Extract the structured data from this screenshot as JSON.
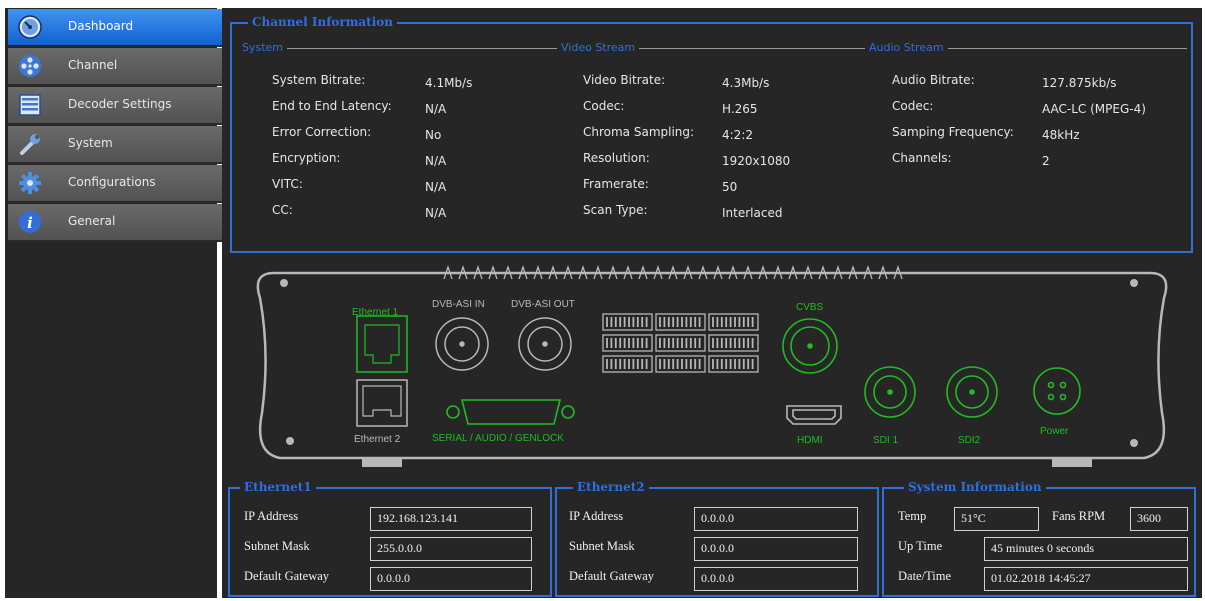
{
  "sidebar": {
    "items": [
      {
        "label": "Dashboard",
        "icon": "gauge-icon",
        "active": true
      },
      {
        "label": "Channel",
        "icon": "film-reel-icon",
        "active": false
      },
      {
        "label": "Decoder Settings",
        "icon": "list-icon",
        "active": false
      },
      {
        "label": "System",
        "icon": "wrench-icon",
        "active": false
      },
      {
        "label": "Configurations",
        "icon": "gear-icon",
        "active": false
      },
      {
        "label": "General",
        "icon": "info-icon",
        "active": false
      }
    ]
  },
  "channel_info": {
    "title": "Channel Information",
    "system": {
      "title": "System",
      "rows": [
        {
          "label": "System Bitrate:",
          "value": "4.1Mb/s"
        },
        {
          "label": "End to End Latency:",
          "value": "N/A"
        },
        {
          "label": "Error Correction:",
          "value": "No"
        },
        {
          "label": "Encryption:",
          "value": "N/A"
        },
        {
          "label": "VITC:",
          "value": "N/A"
        },
        {
          "label": "CC:",
          "value": "N/A"
        }
      ]
    },
    "video": {
      "title": "Video Stream",
      "rows": [
        {
          "label": "Video Bitrate:",
          "value": "4.3Mb/s"
        },
        {
          "label": "Codec:",
          "value": "H.265"
        },
        {
          "label": "Chroma Sampling:",
          "value": "4:2:2"
        },
        {
          "label": "Resolution:",
          "value": "1920x1080"
        },
        {
          "label": "Framerate:",
          "value": "50"
        },
        {
          "label": "Scan Type:",
          "value": "Interlaced"
        }
      ]
    },
    "audio": {
      "title": "Audio Stream",
      "rows": [
        {
          "label": "Audio Bitrate:",
          "value": "127.875kb/s"
        },
        {
          "label": "Codec:",
          "value": "AAC-LC (MPEG-4)"
        },
        {
          "label": "Samping Frequency:",
          "value": "48kHz"
        },
        {
          "label": "Channels:",
          "value": "2"
        }
      ]
    }
  },
  "device": {
    "ports": {
      "ethernet1": "Ethernet 1",
      "ethernet2": "Ethernet 2",
      "dvb_asi_in": "DVB-ASI IN",
      "dvb_asi_out": "DVB-ASI OUT",
      "cvbs": "CVBS",
      "hdmi": "HDMI",
      "sdi1": "SDI 1",
      "sdi2": "SDI2",
      "power": "Power",
      "serial": "SERIAL / AUDIO / GENLOCK"
    },
    "colors": {
      "active": "#22bb22",
      "inactive": "#b8b8b8"
    }
  },
  "ethernet1": {
    "title": "Ethernet1",
    "ip_label": "IP Address",
    "ip": "192.168.123.141",
    "mask_label": "Subnet Mask",
    "mask": "255.0.0.0",
    "gw_label": "Default Gateway",
    "gw": "0.0.0.0"
  },
  "ethernet2": {
    "title": "Ethernet2",
    "ip_label": "IP Address",
    "ip": "0.0.0.0",
    "mask_label": "Subnet Mask",
    "mask": "0.0.0.0",
    "gw_label": "Default Gateway",
    "gw": "0.0.0.0"
  },
  "sysinfo": {
    "title": "System Information",
    "temp_label": "Temp",
    "temp": "51°C",
    "fans_label": "Fans RPM",
    "fans": "3600",
    "uptime_label": "Up Time",
    "uptime": "45 minutes 0 seconds",
    "datetime_label": "Date/Time",
    "datetime": "01.02.2018 14:45:27"
  },
  "theme": {
    "accent": "#2f6fd6",
    "panel": "#262626"
  }
}
